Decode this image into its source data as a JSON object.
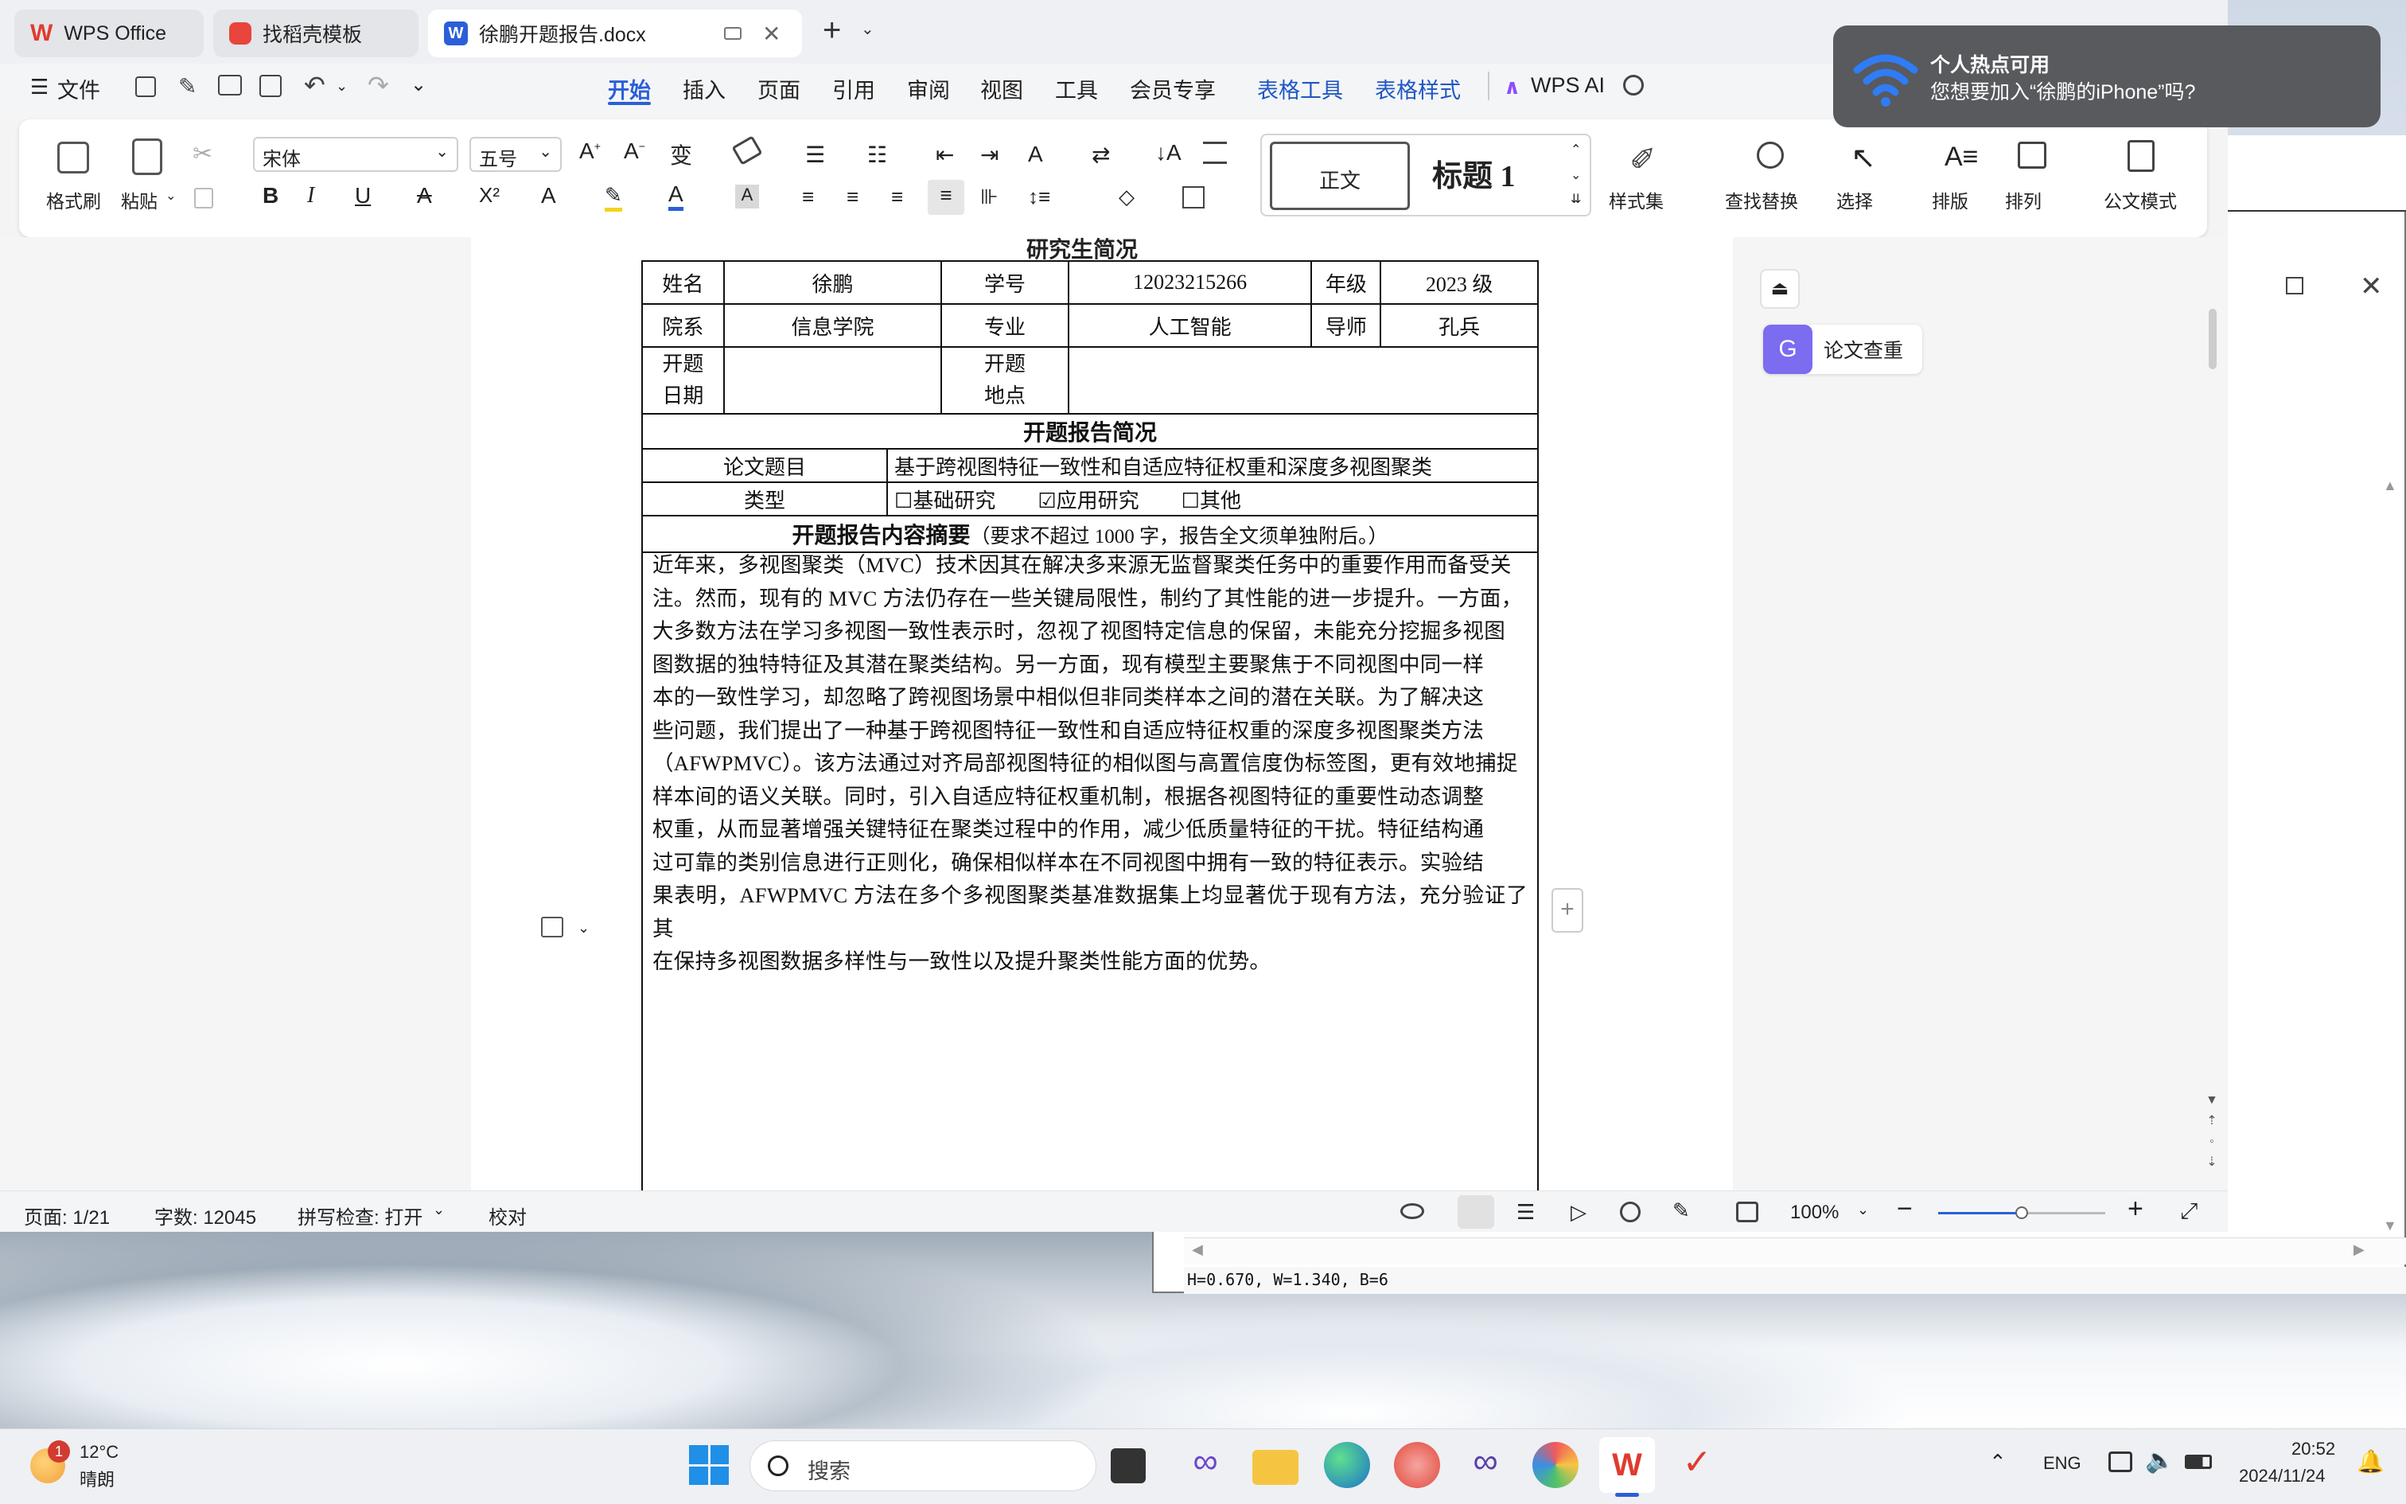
{
  "tabs": [
    {
      "label": "WPS Office",
      "active": false
    },
    {
      "label": "找稻壳模板",
      "active": false
    },
    {
      "label": "徐鹏开题报告.docx",
      "active": true
    }
  ],
  "menu": {
    "file": "文件",
    "items": [
      "开始",
      "插入",
      "页面",
      "引用",
      "审阅",
      "视图",
      "工具",
      "会员专享"
    ],
    "active": "开始",
    "table_tools": "表格工具",
    "table_style": "表格样式",
    "wps_ai": "WPS AI"
  },
  "ribbon": {
    "format_painter": "格式刷",
    "paste": "粘贴",
    "font_name": "宋体",
    "font_size": "五号",
    "style_normal": "正文",
    "style_heading": "标题 1",
    "style_set": "样式集",
    "find_replace": "查找替换",
    "select": "选择",
    "layout": "排版",
    "arrange": "排列",
    "official_mode": "公文模式"
  },
  "document": {
    "cut_heading": "研究生简况",
    "row1": {
      "name_label": "姓名",
      "name": "徐鹏",
      "id_label": "学号",
      "id": "12023215266",
      "grade_label": "年级",
      "grade": "2023 级"
    },
    "row2": {
      "dept_label": "院系",
      "dept": "信息学院",
      "major_label": "专业",
      "major": "人工智能",
      "advisor_label": "导师",
      "advisor": "孔兵"
    },
    "row3": {
      "date_label_1": "开题",
      "date_label_2": "日期",
      "place_label_1": "开题",
      "place_label_2": "地点"
    },
    "section_title": "开题报告简况",
    "topic_label": "论文题目",
    "topic": "基于跨视图特征一致性和自适应特征权重和深度多视图聚类",
    "type_label": "类型",
    "type_options": [
      "基础研究",
      "应用研究",
      "其他"
    ],
    "type_checked": "应用研究",
    "summary_title": "开题报告内容摘要",
    "summary_note": "（要求不超过 1000 字，报告全文须单独附后。）",
    "abstract_lines": [
      "近年来，多视图聚类（MVC）技术因其在解决多来源无监督聚类任务中的重要作用而备受关",
      "注。然而，现有的 MVC 方法仍存在一些关键局限性，制约了其性能的进一步提升。一方面，",
      "大多数方法在学习多视图一致性表示时，忽视了视图特定信息的保留，未能充分挖掘多视图",
      "图数据的独特特征及其潜在聚类结构。另一方面，现有模型主要聚焦于不同视图中同一样",
      "本的一致性学习，却忽略了跨视图场景中相似但非同类样本之间的潜在关联。为了解决这",
      "些问题，我们提出了一种基于跨视图特征一致性和自适应特征权重的深度多视图聚类方法",
      "（AFWPMVC）。该方法通过对齐局部视图特征的相似图与高置信度伪标签图，更有效地捕捉",
      "样本间的语义关联。同时，引入自适应特征权重机制，根据各视图特征的重要性动态调整",
      "权重，从而显著增强关键特征在聚类过程中的作用，减少低质量特征的干扰。特征结构通",
      "过可靠的类别信息进行正则化，确保相似样本在不同视图中拥有一致的特征表示。实验结",
      "果表明，AFWPMVC 方法在多个多视图聚类基准数据集上均显著优于现有方法，充分验证了其",
      "在保持多视图数据多样性与一致性以及提升聚类性能方面的优势。"
    ]
  },
  "side_panel": {
    "plagiarism_check": "论文查重"
  },
  "status": {
    "page": "页面: 1/21",
    "words": "字数: 12045",
    "spell": "拼写检查: 打开",
    "proof": "校对",
    "zoom": "100%",
    "zoom_level": 0.5
  },
  "toast": {
    "title": "个人热点可用",
    "body": "您想要加入“徐鹏的iPhone”吗?"
  },
  "back_window": {
    "status_text": "H=0.670, W=1.340, B=6"
  },
  "taskbar": {
    "weather_temp": "12°C",
    "weather_desc": "晴朗",
    "weather_badge": "1",
    "search": "搜索",
    "lang": "ENG",
    "time": "20:52",
    "date": "2024/11/24"
  },
  "colors": {
    "accent": "#2b5fd9",
    "wps_red": "#e03b2f",
    "heading_blue": "#1f57c3"
  }
}
